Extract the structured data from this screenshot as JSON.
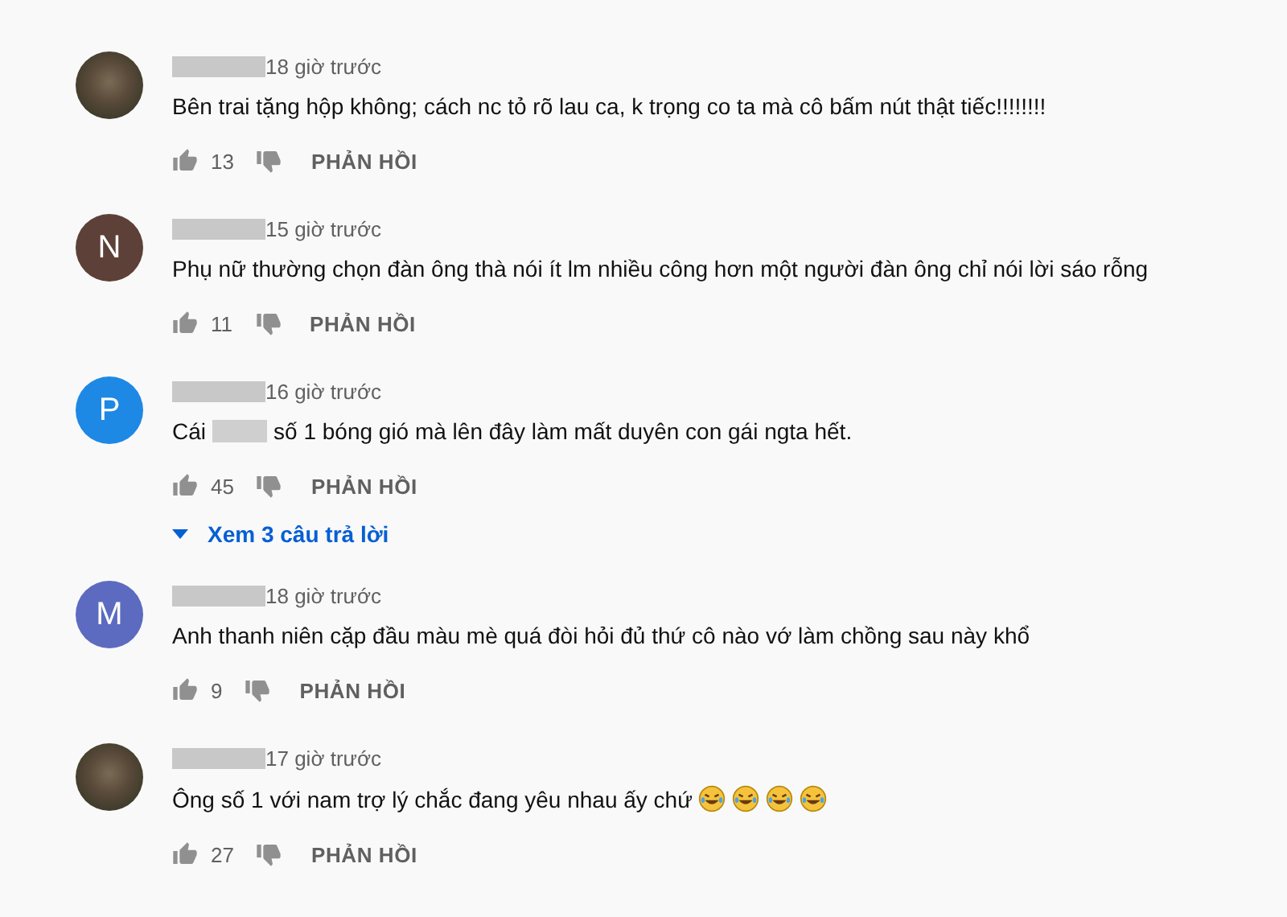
{
  "comments": [
    {
      "avatar": {
        "kind": "photo"
      },
      "time": "18 giờ trước",
      "text": [
        {
          "kind": "text",
          "value": "Bên trai tặng hộp không;  cách nc tỏ rõ  lau ca, k trọng  co ta mà cô bấm nút thật tiếc!!!!!!!!"
        }
      ],
      "likes": "13",
      "reply": "PHẢN HỒI"
    },
    {
      "avatar": {
        "kind": "letter",
        "letter": "N",
        "color": "#5d4037"
      },
      "time": "15 giờ trước",
      "text": [
        {
          "kind": "text",
          "value": "Phụ nữ thường chọn đàn ông thà nói ít lm nhiều công hơn một người đàn ông chỉ nói lời sáo rỗng"
        }
      ],
      "likes": "11",
      "reply": "PHẢN HỒI"
    },
    {
      "avatar": {
        "kind": "letter",
        "letter": "P",
        "color": "#1e88e5"
      },
      "time": "16 giờ trước",
      "text": [
        {
          "kind": "text",
          "value": "Cái"
        },
        {
          "kind": "redacted"
        },
        {
          "kind": "text",
          "value": "số 1 bóng gió mà lên đây làm mất duyên con gái ngta hết."
        }
      ],
      "likes": "45",
      "reply": "PHẢN HỒI",
      "replies_link": "Xem 3 câu trả lời"
    },
    {
      "avatar": {
        "kind": "letter",
        "letter": "M",
        "color": "#5c6bc0"
      },
      "time": "18 giờ trước",
      "text": [
        {
          "kind": "text",
          "value": "Anh thanh niên cặp đầu màu mè quá đòi hỏi đủ thứ cô nào vớ làm chồng sau này khổ"
        }
      ],
      "likes": "9",
      "reply": "PHẢN HỒI"
    },
    {
      "avatar": {
        "kind": "photo"
      },
      "time": "17 giờ trước",
      "text": [
        {
          "kind": "text",
          "value": "Ông số 1 với nam trợ lý chắc đang yêu nhau ấy chứ"
        },
        {
          "kind": "emoji"
        },
        {
          "kind": "emoji"
        },
        {
          "kind": "emoji"
        },
        {
          "kind": "emoji"
        }
      ],
      "likes": "27",
      "reply": "PHẢN HỒI"
    }
  ]
}
